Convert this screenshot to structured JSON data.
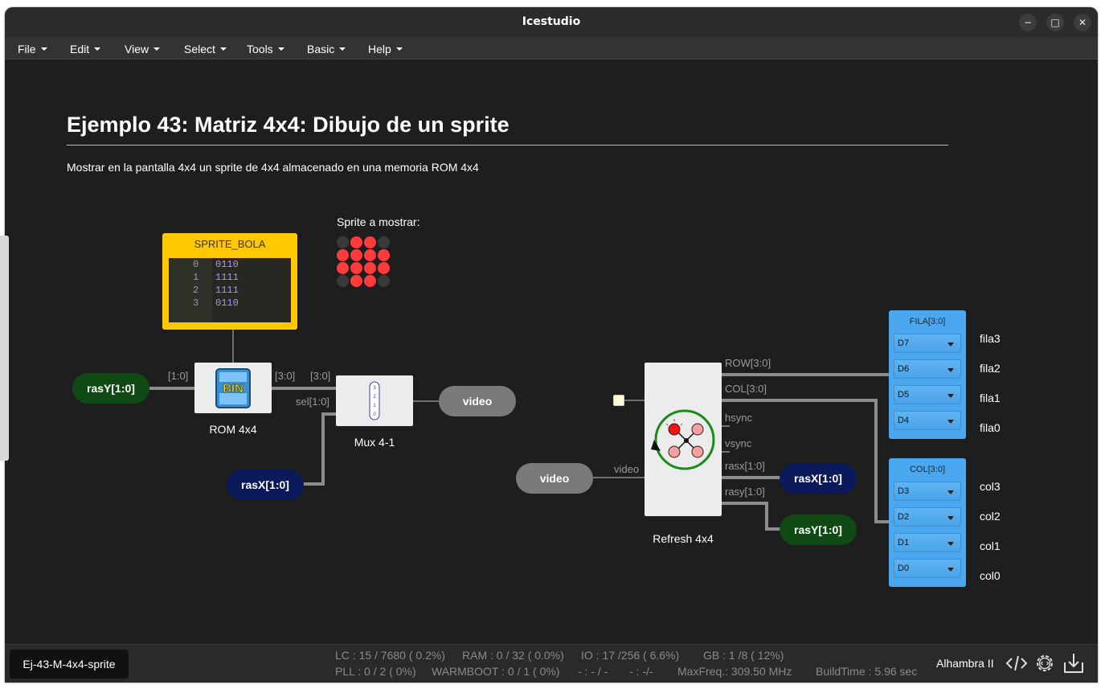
{
  "window": {
    "title": "Icestudio",
    "controls": [
      "−",
      "□",
      "✕"
    ]
  },
  "menu": [
    {
      "label": "File"
    },
    {
      "label": "Edit"
    },
    {
      "label": "View"
    },
    {
      "label": "Select"
    },
    {
      "label": "Tools"
    },
    {
      "label": "Basic"
    },
    {
      "label": "Help"
    }
  ],
  "doc": {
    "title": "Ejemplo 43: Matriz 4x4: Dibujo de un sprite",
    "subtitle": "Mostrar en la pantalla 4x4 un sprite de 4x4 almacenado en una memoria ROM 4x4",
    "sprite_caption": "Sprite a mostrar:"
  },
  "rom": {
    "name": "SPRITE_BOLA",
    "lines": [
      {
        "n": "0",
        "v": "0110"
      },
      {
        "n": "1",
        "v": "1111"
      },
      {
        "n": "2",
        "v": "1111"
      },
      {
        "n": "3",
        "v": "0110"
      }
    ]
  },
  "sprite": [
    [
      0,
      1,
      1,
      0
    ],
    [
      1,
      1,
      1,
      1
    ],
    [
      1,
      1,
      1,
      1
    ],
    [
      0,
      1,
      1,
      0
    ]
  ],
  "colors": {
    "led_on": "#ff3b3b",
    "led_off": "#3a3a3a",
    "input_green": "#0f4a14",
    "input_navy": "#0b1a5a",
    "video_gray": "#7a7a7a",
    "pin_blue": "#4aa8f0",
    "rom_yellow": "#ffc800"
  },
  "blocks": {
    "rom4x4": {
      "label": "ROM 4x4",
      "icon": "BIN"
    },
    "mux": {
      "label": "Mux 4-1",
      "icon_bits": [
        "3",
        "2",
        "1",
        "0"
      ]
    },
    "refresh": {
      "label": "Refresh 4x4"
    }
  },
  "pills": {
    "rasY_in": "rasY[1:0]",
    "rasX_in": "rasX[1:0]",
    "video_out": "video",
    "video_in": "video",
    "rasX_out": "rasX[1:0]",
    "rasY_out": "rasY[1:0]"
  },
  "wire_labels": {
    "w10": "[1:0]",
    "w30a": "[3:0]",
    "w30b": "[3:0]",
    "sel": "sel[1:0]",
    "row": "ROW[3:0]",
    "col": "COL[3:0]",
    "hsync": "hsync",
    "vsync": "vsync",
    "rasx": "rasx[1:0]",
    "rasy": "rasy[1:0]",
    "video": "video"
  },
  "fila_panel": {
    "title": "FILA[3:0]",
    "pins": [
      {
        "sel": "D7",
        "name": "fila3"
      },
      {
        "sel": "D6",
        "name": "fila2"
      },
      {
        "sel": "D5",
        "name": "fila1"
      },
      {
        "sel": "D4",
        "name": "fila0"
      }
    ]
  },
  "col_panel": {
    "title": "COL[3:0]",
    "pins": [
      {
        "sel": "D3",
        "name": "col3"
      },
      {
        "sel": "D2",
        "name": "col2"
      },
      {
        "sel": "D1",
        "name": "col1"
      },
      {
        "sel": "D0",
        "name": "col0"
      }
    ]
  },
  "status": {
    "file": "Ej-43-M-4x4-sprite",
    "lc": "LC : 15 / 7680 ( 0.2%)",
    "ram": "RAM : 0 / 32 ( 0.0%)",
    "io": "IO :  17 /256  ( 6.6%)",
    "gb": "GB :  1 /8  ( 12%)",
    "pll": "PLL : 0 / 2 ( 0%)",
    "warmboot": "WARMBOOT : 0 / 1 ( 0%)",
    "dash1": "- : - / -",
    "dash2": "- :  -/-",
    "maxfreq": "MaxFreq.:  309.50 MHz",
    "buildtime": "BuildTime :  5.96 sec",
    "board": "Alhambra II"
  },
  "icons": [
    "code-icon",
    "settings-icon",
    "upload-icon"
  ]
}
